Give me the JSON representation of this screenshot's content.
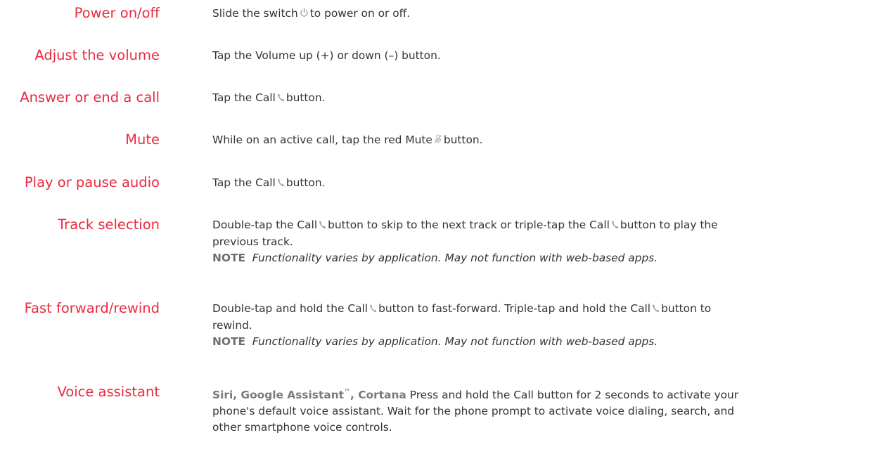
{
  "colors": {
    "term": "#ea2a3e",
    "text": "#333333",
    "note_label": "#6e6e6e",
    "icon": "#9a9a9a"
  },
  "rows": [
    {
      "term": "Power on/off",
      "parts": [
        "Slide the switch",
        "to power on or off."
      ],
      "icon": "power-icon"
    },
    {
      "term": "Adjust the volume",
      "text": "Tap the Volume up (+) or down (–) button."
    },
    {
      "term": "Answer or end a call",
      "parts": [
        "Tap the Call",
        "button."
      ],
      "icon": "phone-icon"
    },
    {
      "term": "Mute",
      "parts": [
        "While on an active call, tap the red Mute",
        "button."
      ],
      "icon": "mic-mute-icon"
    },
    {
      "term": "Play or pause audio",
      "parts": [
        "Tap the Call",
        "button."
      ],
      "icon": "phone-icon"
    },
    {
      "term": "Track selection",
      "line1_parts": [
        "Double-tap the Call",
        "button to skip to the next track or triple-tap the Call",
        "button to play the"
      ],
      "line2": "previous track.",
      "note_label": "NOTE",
      "note_text": "Functionality varies by application. May not function with web-based apps.",
      "icon": "phone-icon"
    },
    {
      "term": "Fast forward/rewind",
      "line1_parts": [
        "Double-tap and hold the Call",
        "button to fast-forward. Triple-tap and hold the Call",
        "button to"
      ],
      "line2": "rewind.",
      "note_label": "NOTE",
      "note_text": "Functionality varies by application. May not function with web-based apps.",
      "icon": "phone-icon"
    },
    {
      "term": "Voice assistant",
      "label_before": "Siri, Google Assistant",
      "label_tm": "™",
      "label_after": ", Cortana",
      "line1_rest": "Press and hold the Call button for 2 seconds to activate your",
      "line2": "phone's default voice assistant. Wait for the phone prompt to activate voice dialing, search, and",
      "line3": "other smartphone voice controls."
    }
  ]
}
